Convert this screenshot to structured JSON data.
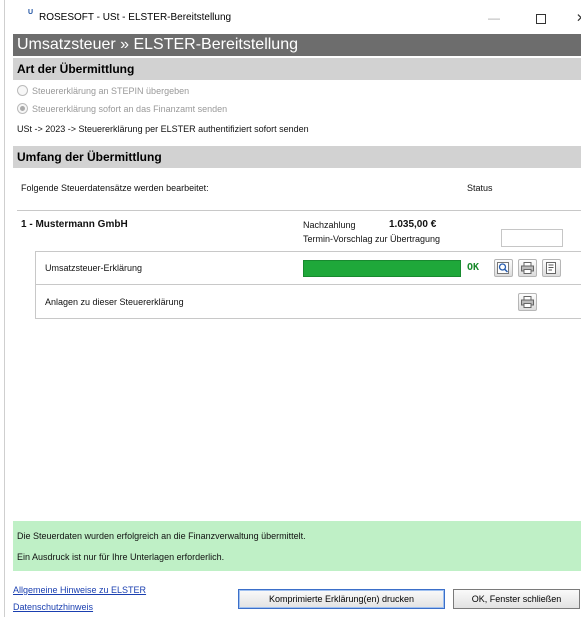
{
  "window": {
    "app_logo": "U",
    "title": "ROSESOFT - USt - ELSTER-Bereitstellung",
    "minimize": "—",
    "close": "✕"
  },
  "header": {
    "title": "Umsatzsteuer » ELSTER-Bereitstellung"
  },
  "transmission": {
    "section_title": "Art der Übermittlung",
    "options": [
      {
        "label": "Steuererklärung an STEPIN übergeben",
        "selected": false
      },
      {
        "label": "Steuererklärung sofort an das Finanzamt senden",
        "selected": true
      }
    ],
    "path_text": "USt -> 2023 -> Steuererklärung per ELSTER authentifiziert sofort senden"
  },
  "scope": {
    "section_title": "Umfang der Übermittlung",
    "intro": "Folgende Steuerdatensätze werden bearbeitet:",
    "status_header": "Status",
    "company": {
      "name": "1 - Mustermann GmbH",
      "payment_label": "Nachzahlung",
      "payment_amount": "1.035,00 €",
      "date_suggestion_label": "Termin-Vorschlag zur Übertragung",
      "date_value": ""
    },
    "rows": [
      {
        "label": "Umsatzsteuer-Erklärung",
        "progress": 1.0,
        "status": "OK",
        "icons": [
          "preview-icon",
          "print-icon",
          "details-icon"
        ]
      },
      {
        "label": "Anlagen zu dieser Steuererklärung",
        "icons": [
          "print-icon"
        ]
      }
    ]
  },
  "info": {
    "message1": "Die Steuerdaten wurden erfolgreich an die Finanzverwaltung übermittelt.",
    "message2": "Ein Ausdruck ist nur für Ihre Unterlagen erforderlich."
  },
  "footer": {
    "link1": "Allgemeine Hinweise zu ELSTER",
    "link2": "Datenschutzhinweis",
    "print_button": "Komprimierte Erklärung(en) drucken",
    "close_button": "OK, Fenster schließen"
  },
  "colors": {
    "header_band": "#6d6d6d",
    "section_band": "#d2d2d2",
    "progress": "#1fa83a",
    "ok_text": "#1a8a2c",
    "info_panel": "#bff0c6",
    "link": "#1a3fb0"
  }
}
